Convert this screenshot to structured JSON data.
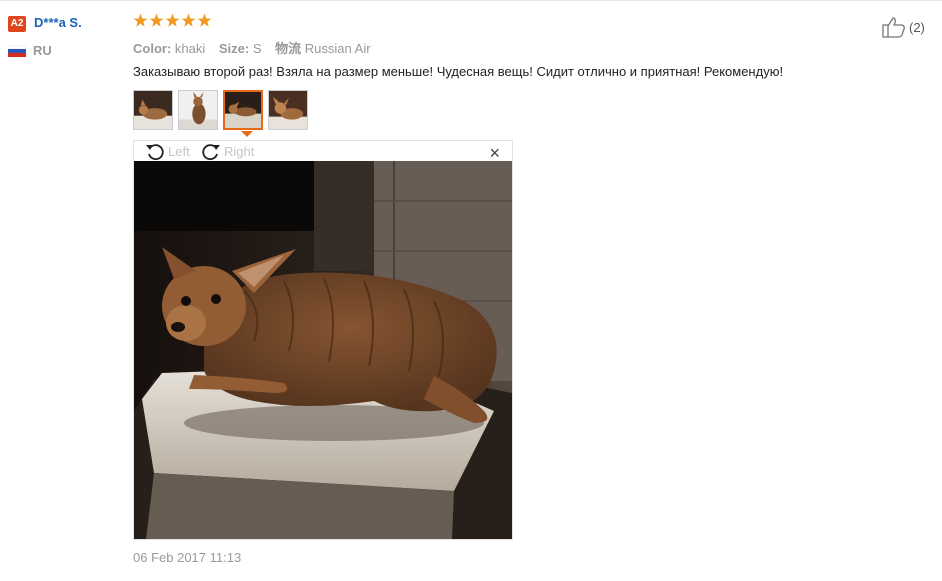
{
  "reviewer": {
    "level_badge": "A2",
    "name": "D***a S.",
    "country": "RU",
    "flag_icon": "russia-flag-icon"
  },
  "review": {
    "rating": 5,
    "rating_max": 5,
    "color_label": "Color:",
    "color_value": "khaki",
    "size_label": "Size:",
    "size_value": "S",
    "shipping_label": "物流",
    "shipping_value": "Russian Air",
    "text": "Заказываю второй раз! Взяла на размер меньше! Чудесная вещь! Сидит отлично и приятная! Рекомендую!",
    "date": "06 Feb 2017 11:13",
    "helpful_count": "(2)"
  },
  "thumbnails": {
    "count": 4,
    "selected_index": 2
  },
  "viewer": {
    "rotate_left_label": "Left",
    "rotate_right_label": "Right",
    "close_glyph": "×"
  },
  "colors": {
    "star": "#f29a1e",
    "username": "#1a64b5",
    "badge": "#e0461c",
    "selected_thumb_border": "#e66a1a"
  }
}
